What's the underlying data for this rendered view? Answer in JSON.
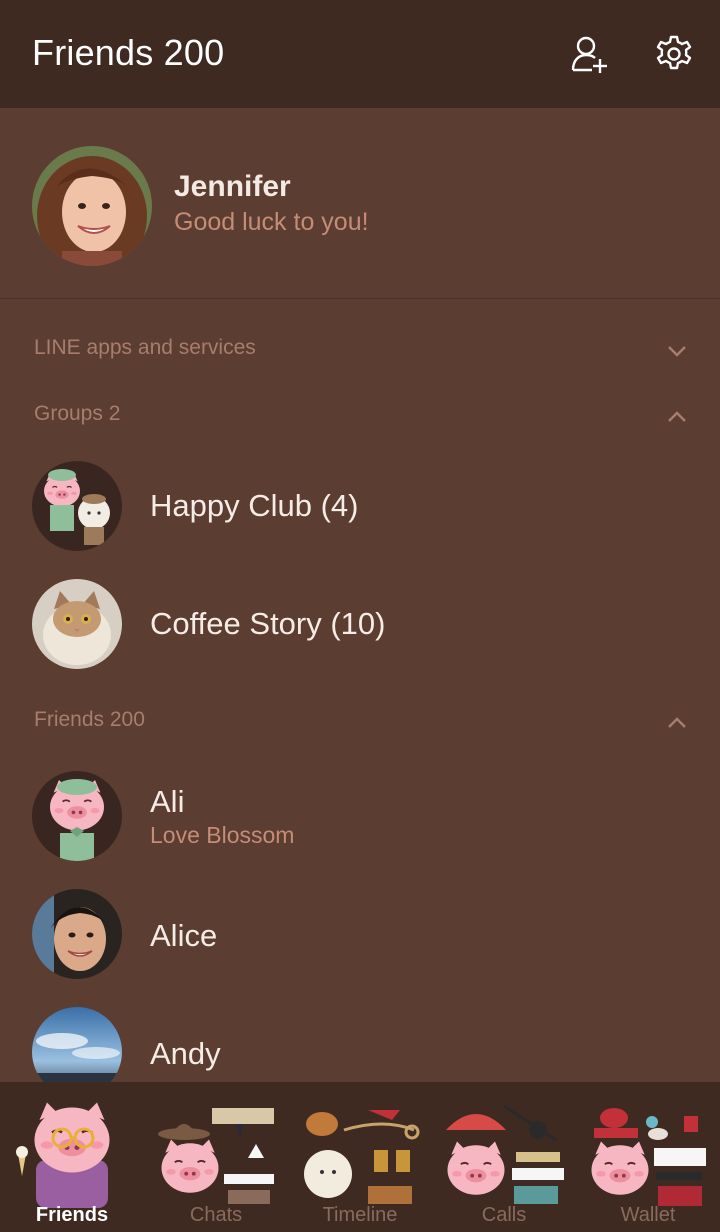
{
  "header": {
    "title": "Friends 200",
    "add_friend_icon": "add-friend-icon",
    "settings_icon": "gear-icon"
  },
  "profile": {
    "name": "Jennifer",
    "status": "Good luck to you!"
  },
  "sections": {
    "services": {
      "label": "LINE apps and services",
      "expanded": false
    },
    "groups": {
      "label": "Groups 2",
      "expanded": true
    },
    "friends": {
      "label": "Friends 200",
      "expanded": true
    }
  },
  "groups": [
    {
      "name": "Happy Club (4)"
    },
    {
      "name": "Coffee Story (10)"
    }
  ],
  "friends": [
    {
      "name": "Ali",
      "status": "Love Blossom"
    },
    {
      "name": "Alice",
      "status": ""
    },
    {
      "name": "Andy",
      "status": ""
    }
  ],
  "tabs": [
    {
      "label": "Friends",
      "active": true
    },
    {
      "label": "Chats",
      "active": false
    },
    {
      "label": "Timeline",
      "active": false
    },
    {
      "label": "Calls",
      "active": false
    },
    {
      "label": "Wallet",
      "active": false
    }
  ],
  "colors": {
    "header_bg": "#3f2a22",
    "body_bg": "#5b3d31",
    "accent_text": "#c58c76",
    "section_text": "#a87d6b"
  }
}
